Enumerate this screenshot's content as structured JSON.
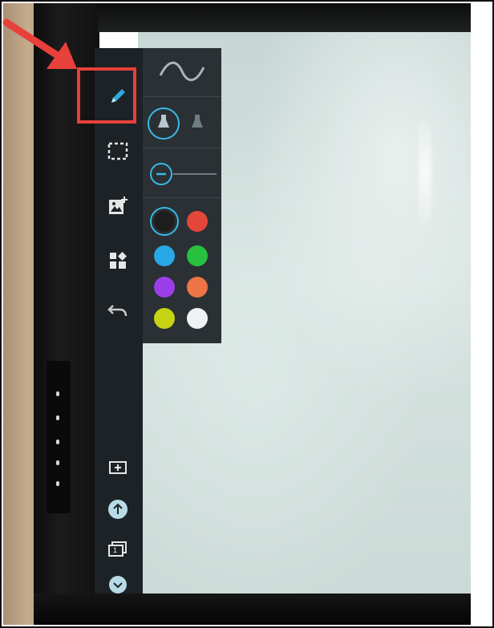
{
  "toolbar": {
    "tools": [
      {
        "name": "pen",
        "icon": "pen-icon",
        "selected": true
      },
      {
        "name": "selection",
        "icon": "dashed-selection-icon"
      },
      {
        "name": "insert-image",
        "icon": "image-add-icon"
      },
      {
        "name": "apps",
        "icon": "grid-icon"
      },
      {
        "name": "undo",
        "icon": "undo-icon"
      }
    ],
    "bottom_tools": [
      {
        "name": "add-page",
        "icon": "add-page-icon"
      },
      {
        "name": "upload",
        "icon": "upload-icon"
      },
      {
        "name": "page-number",
        "icon": "page-icon",
        "label": "1"
      },
      {
        "name": "collapse",
        "icon": "chevron-down-icon"
      }
    ]
  },
  "pen_panel": {
    "stroke_icon": "wave-icon",
    "pen_types": [
      "pen-type-standard-icon",
      "pen-type-brush-icon"
    ],
    "thickness_icon": "thickness-slider-icon",
    "colors": [
      {
        "name": "black",
        "hex": "#1e1e1e",
        "selected": true
      },
      {
        "name": "red",
        "hex": "#e3473a"
      },
      {
        "name": "blue",
        "hex": "#28a8e6"
      },
      {
        "name": "green",
        "hex": "#27c13f"
      },
      {
        "name": "purple",
        "hex": "#9b3ee8"
      },
      {
        "name": "orange",
        "hex": "#ec7447"
      },
      {
        "name": "yellow",
        "hex": "#c6d414"
      },
      {
        "name": "white",
        "hex": "#eef2f4"
      }
    ]
  },
  "annotation": {
    "arrow_color": "#e8403b",
    "box_color": "#e8403b"
  },
  "accent_color": "#38b9e6"
}
